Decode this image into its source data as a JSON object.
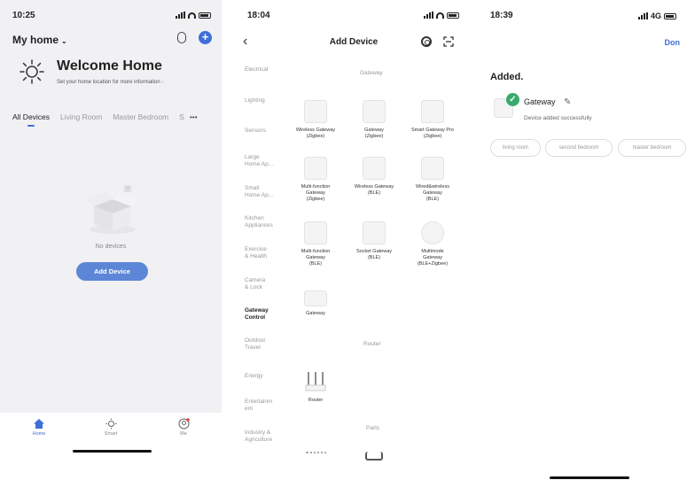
{
  "screen1": {
    "time": "10:25",
    "home_name": "My home",
    "welcome": "Welcome Home",
    "location_prompt": "Set your home location for more information",
    "tabs": [
      "All Devices",
      "Living Room",
      "Master Bedroom",
      "S"
    ],
    "more": "•••",
    "empty_text": "No devices",
    "add_device": "Add Device",
    "tabbar": {
      "home": "Home",
      "smart": "Smart",
      "me": "Me"
    }
  },
  "screen2": {
    "time": "18:04",
    "title": "Add Device",
    "categories": [
      "Electrical",
      "Lighting",
      "Sensors",
      "Large\nHome Ap...",
      "Small\nHome Ap...",
      "Kitchen\nAppliances",
      "Exercise\n& Health",
      "Camera\n& Lock",
      "Gateway\nControl",
      "Outdoor\nTravel",
      "Energy",
      "Entertainm\nent",
      "Industry &\nAgriculture"
    ],
    "active_category": "Gateway\nControl",
    "sections": {
      "gateway": "Gateway",
      "router": "Router",
      "parts": "Parts"
    },
    "gateway_devices": [
      "Wireless Gateway\n(Zigbee)",
      "Gateway\n(Zigbee)",
      "Smart Gateway Pro\n(Zigbee)",
      "Multi-function\nGateway\n(Zigbee)",
      "Wireless Gateway\n(BLE)",
      "Wired&wireless\nGateway\n(BLE)",
      "Multi-function\nGateway\n(BLE)",
      "Socket Gateway\n(BLE)",
      "Multimode\nGateway\n(BLE+Zigbee)",
      "Gateway"
    ],
    "router_devices": [
      "Router"
    ]
  },
  "screen3": {
    "time": "18:39",
    "network": "4G",
    "done": "Don",
    "added": "Added.",
    "device_name": "Gateway",
    "status": "Device added successfully",
    "rooms": [
      "living room",
      "second bedroom",
      "master bedroom"
    ]
  },
  "colors": {
    "accent": "#3e6fd8",
    "button": "#5d86d6",
    "success": "#3aaa6c"
  }
}
